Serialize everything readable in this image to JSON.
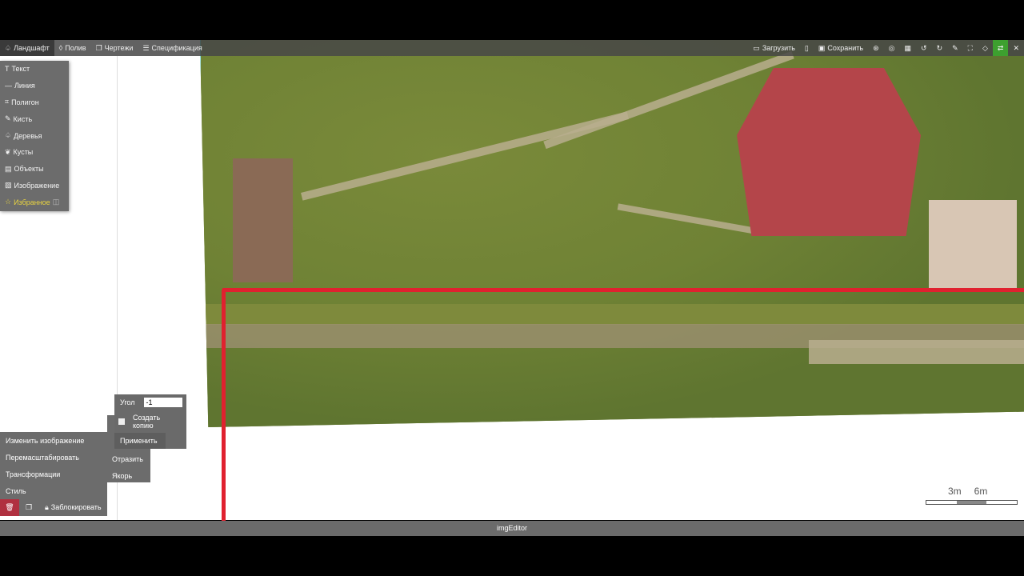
{
  "topbar": {
    "tabs": [
      {
        "label": "Ландшафт",
        "icon": "tree-icon"
      },
      {
        "label": "Полив",
        "icon": "drop-icon"
      },
      {
        "label": "Чертежи",
        "icon": "copy-icon"
      },
      {
        "label": "Спецификация",
        "icon": "list-icon"
      }
    ],
    "load_label": "Загрузить",
    "save_label": "Сохранить"
  },
  "left_menu": [
    "Текст",
    "Линия",
    "Полигон",
    "Кисть",
    "Деревья",
    "Кусты",
    "Объекты",
    "Изображение",
    "Избранное"
  ],
  "context_menu": {
    "items": [
      "Изменить изображение",
      "Перемасштабировать",
      "Трансформации",
      "Стиль"
    ],
    "lock_label": "Заблокировать"
  },
  "submenu": [
    "Отразить",
    "Якорь"
  ],
  "angle_panel": {
    "label": "Угол",
    "value": "-1",
    "copy_label": "Создать копию",
    "apply_label": "Применить"
  },
  "scale": {
    "labels": [
      "3m",
      "6m"
    ]
  },
  "status": {
    "title": "imgEditor"
  },
  "colors": {
    "accent_green": "#3da02f",
    "line_red": "#e0212f",
    "delete_red": "#b03040"
  }
}
